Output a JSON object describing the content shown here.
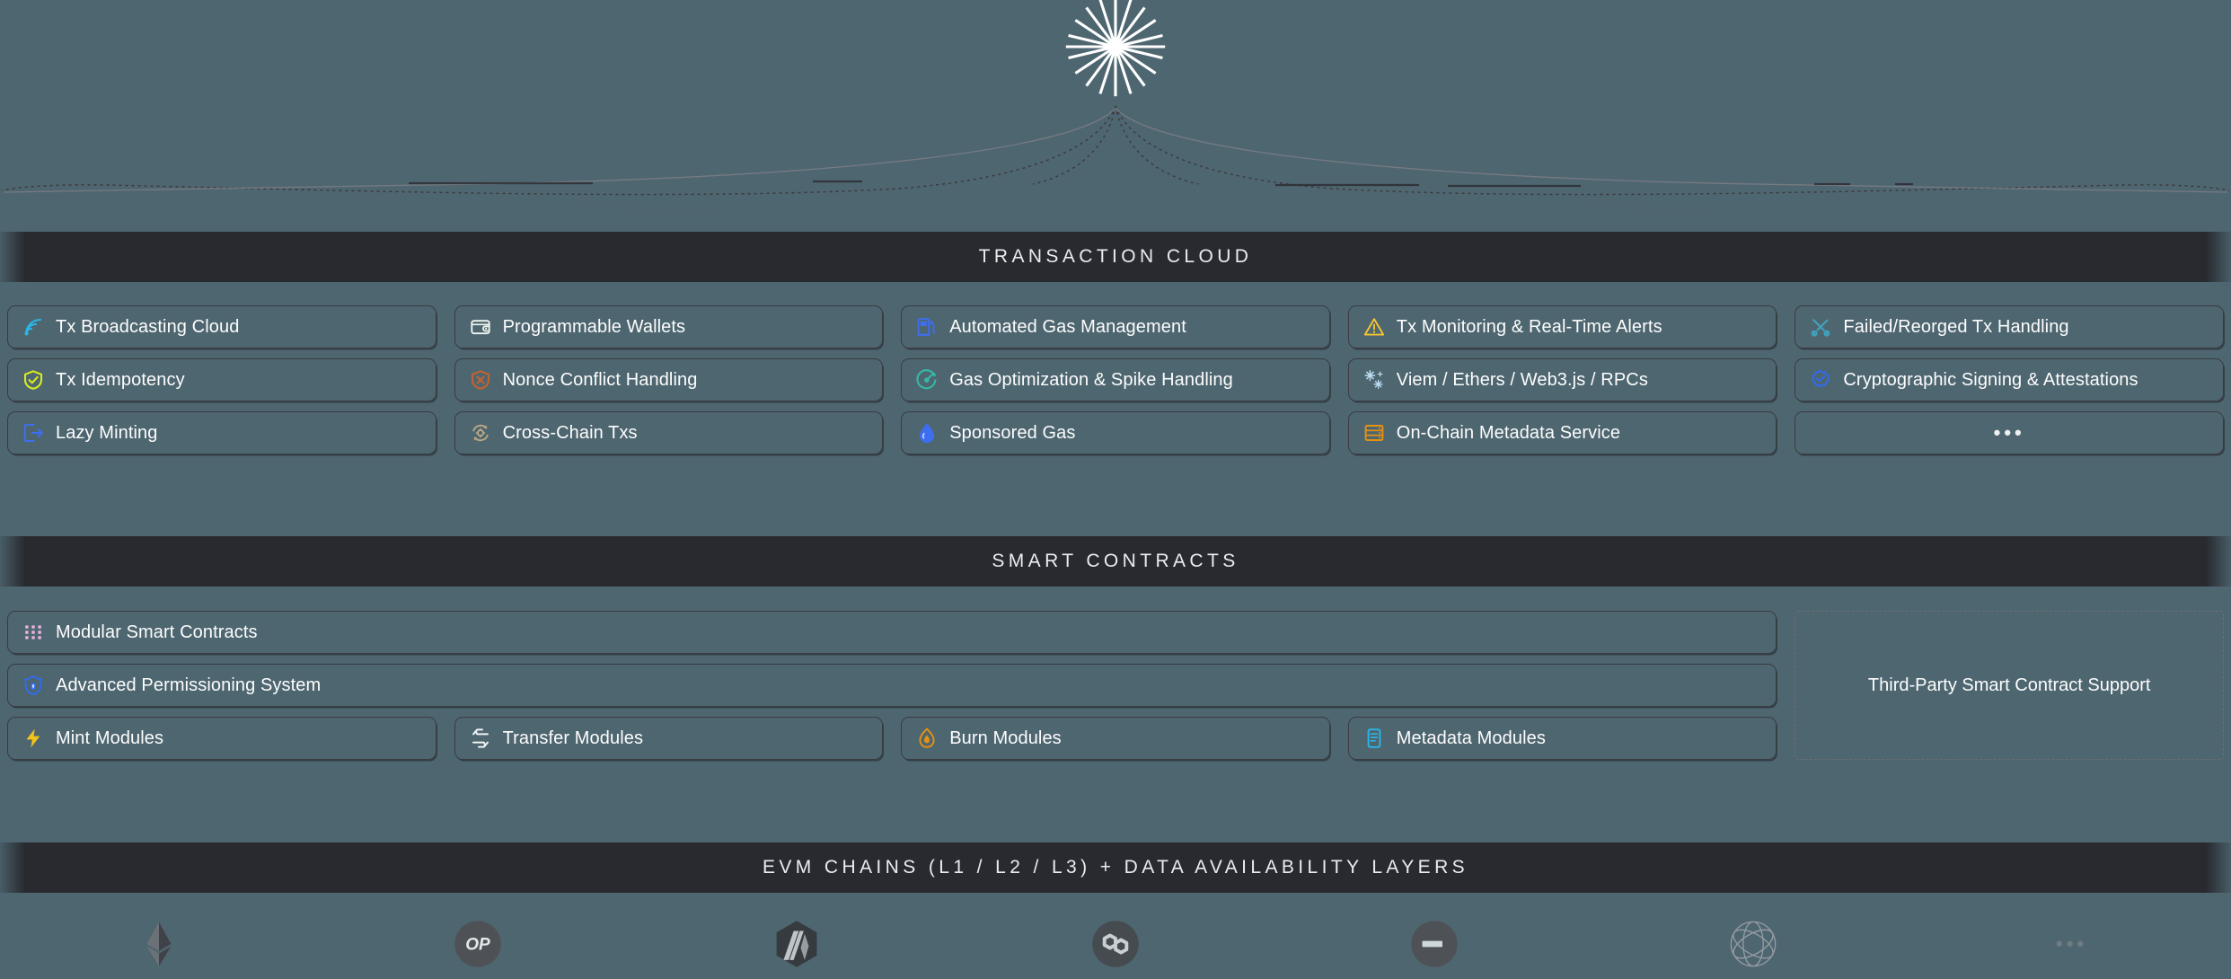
{
  "hero": {
    "icon": "starburst-icon",
    "rays": 20
  },
  "sections": [
    {
      "id": "transaction-cloud",
      "band_label": "TRANSACTION CLOUD"
    },
    {
      "id": "smart-contracts",
      "band_label": "SMART CONTRACTS"
    },
    {
      "id": "evm-chains",
      "band_label": "EVM CHAINS (L1 / L2 / L3) + DATA AVAILABILITY LAYERS"
    }
  ],
  "transaction_cloud": {
    "cards": [
      {
        "label": "Tx Broadcasting Cloud",
        "icon": "broadcast-icon",
        "color": "#29b6e8"
      },
      {
        "label": "Programmable Wallets",
        "icon": "wallet-icon",
        "color": "#eef5ef"
      },
      {
        "label": "Automated Gas Management",
        "icon": "gas-pump-icon",
        "color": "#3d6ef0"
      },
      {
        "label": "Tx Monitoring & Real-Time Alerts",
        "icon": "warning-triangle-icon",
        "color": "#f5c531"
      },
      {
        "label": "Failed/Reorged Tx Handling",
        "icon": "tools-icon",
        "color": "#3fa3bd"
      },
      {
        "label": "Tx Idempotency",
        "icon": "shield-check-icon",
        "color": "#d9eb1e"
      },
      {
        "label": "Nonce Conflict Handling",
        "icon": "shield-x-icon",
        "color": "#c5622f"
      },
      {
        "label": "Gas Optimization & Spike Handling",
        "icon": "gauge-icon",
        "color": "#35b9a6"
      },
      {
        "label": "Viem / Ethers / Web3.js / RPCs",
        "icon": "sparkles-icon",
        "color": "#bcdcf0"
      },
      {
        "label": "Cryptographic Signing & Attestations",
        "icon": "verified-badge-icon",
        "color": "#2f6bf0"
      },
      {
        "label": "Lazy Minting",
        "icon": "export-door-icon",
        "color": "#3d6ef0"
      },
      {
        "label": "Cross-Chain Txs",
        "icon": "refresh-gear-icon",
        "color": "#b9a884"
      },
      {
        "label": "Sponsored Gas",
        "icon": "droplet-icon",
        "color": "#3d6ef0"
      },
      {
        "label": "On-Chain Metadata Service",
        "icon": "server-icon",
        "color": "#e8910f"
      },
      {
        "label": "",
        "icon": "ellipsis-icon",
        "color": "#eef0f2"
      }
    ]
  },
  "smart_contracts": {
    "wide_cards": [
      {
        "label": "Modular Smart Contracts",
        "icon": "grid-dots-icon",
        "color": "#e9b4dd"
      },
      {
        "label": "Advanced Permissioning System",
        "icon": "shield-lock-icon",
        "color": "#2f6bf0"
      }
    ],
    "module_cards": [
      {
        "label": "Mint Modules",
        "icon": "lightning-icon",
        "color": "#f2c319"
      },
      {
        "label": "Transfer Modules",
        "icon": "transfer-arrows-icon",
        "color": "#eef2f4"
      },
      {
        "label": "Burn Modules",
        "icon": "flame-icon",
        "color": "#e8910f"
      },
      {
        "label": "Metadata Modules",
        "icon": "document-list-icon",
        "color": "#29b6e8"
      }
    ],
    "third_party": {
      "label": "Third-Party Smart Contract Support"
    }
  },
  "chains": {
    "logos": [
      {
        "name": "ethereum-logo",
        "label": ""
      },
      {
        "name": "optimism-logo",
        "label": "OP"
      },
      {
        "name": "arbitrum-logo",
        "label": ""
      },
      {
        "name": "polygon-logo",
        "label": ""
      },
      {
        "name": "base-logo",
        "label": ""
      },
      {
        "name": "celestia-logo",
        "label": ""
      },
      {
        "name": "more-chains-ellipsis",
        "label": "•••"
      }
    ]
  },
  "theme": {
    "background": "#4e6670",
    "band_background": "#282a30",
    "card_border": "#3a3c42",
    "text": "#fdfdfd"
  }
}
